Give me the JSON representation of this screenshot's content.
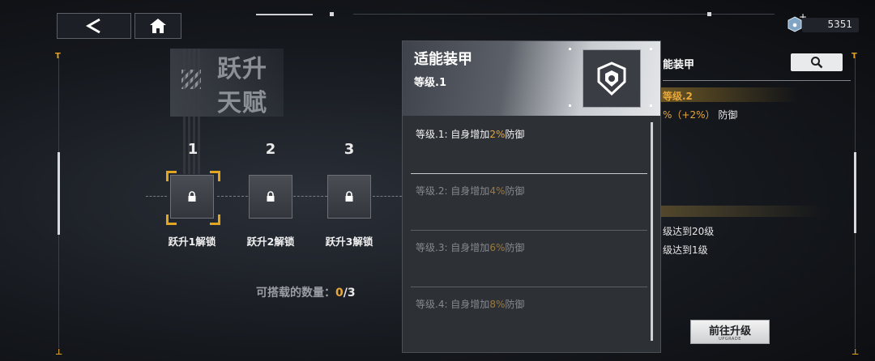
{
  "topbar": {
    "back_icon": "chevron-left-icon",
    "home_icon": "home-icon",
    "currency_value": "5351",
    "currency_icon": "gem-icon"
  },
  "talent": {
    "title_line1": "跃升",
    "title_line2": "天赋",
    "slots": [
      {
        "number": "1",
        "label": "跃升1解锁",
        "locked": true,
        "selected": true
      },
      {
        "number": "2",
        "label": "跃升2解锁",
        "locked": true,
        "selected": false
      },
      {
        "number": "3",
        "label": "跃升3解锁",
        "locked": true,
        "selected": false
      }
    ],
    "count_label": "可搭载的数量：",
    "count_current": "0",
    "count_max": "/3"
  },
  "popup": {
    "title": "适能装甲",
    "level": "等级.1",
    "icon": "armor-shield-icon",
    "levels": [
      {
        "prefix": "等级.1: 自身增加",
        "value": "2%",
        "suffix": "防御"
      },
      {
        "prefix": "等级.2: 自身增加",
        "value": "4%",
        "suffix": "防御"
      },
      {
        "prefix": "等级.3: 自身增加",
        "value": "6%",
        "suffix": "防御"
      },
      {
        "prefix": "等级.4: 自身增加",
        "value": "8%",
        "suffix": "防御"
      }
    ]
  },
  "right_panel": {
    "title": "能装甲",
    "level": "等级.2",
    "effect_prefix": "%（+2%）",
    "effect_suffix": "防御",
    "requirements": [
      "级达到20级",
      "级达到1级"
    ],
    "upgrade_label": "前往升级",
    "upgrade_sub": "UPGRADE"
  },
  "colors": {
    "accent": "#e6a63a",
    "panel": "#2d3035",
    "background": "#15181d"
  }
}
